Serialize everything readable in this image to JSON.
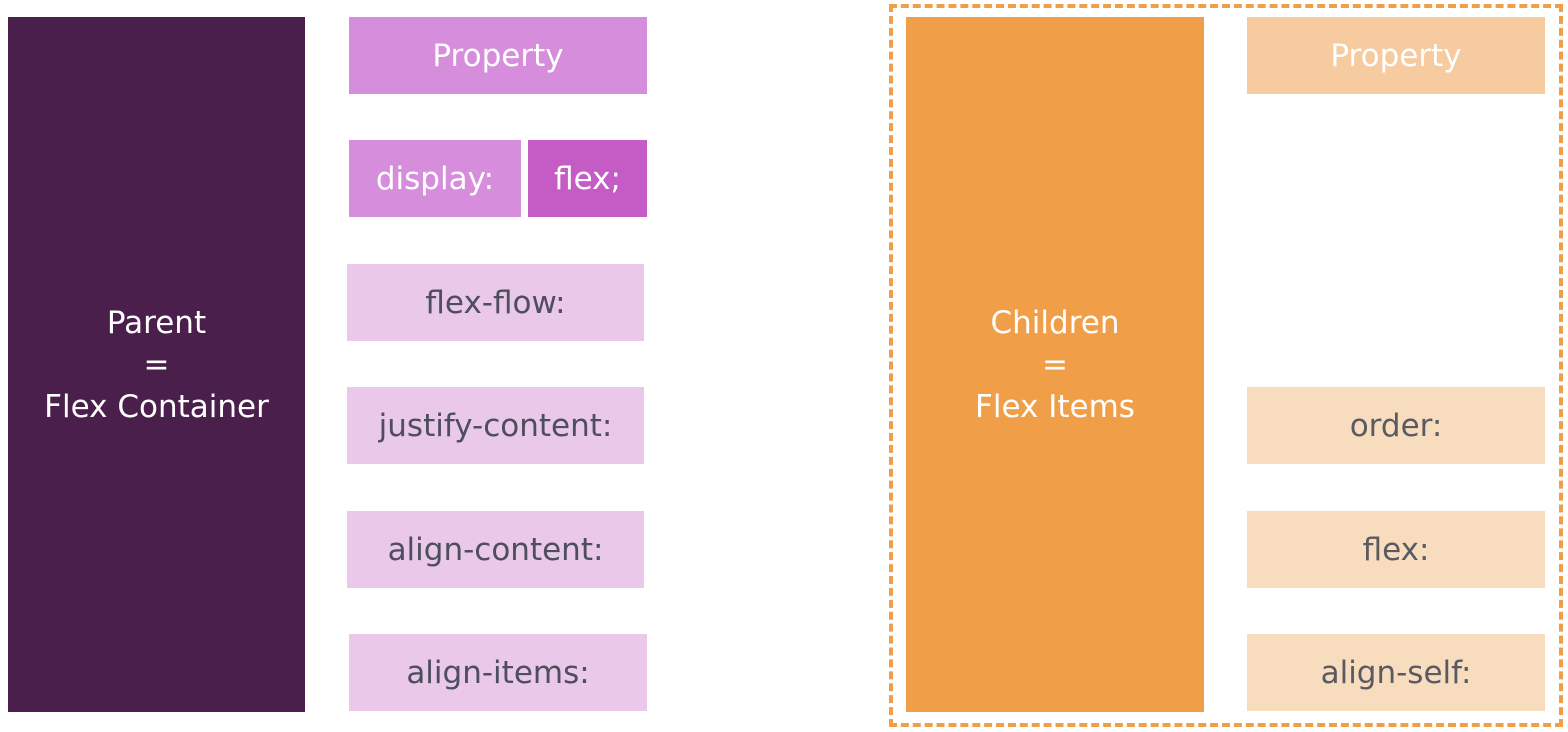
{
  "parent": {
    "line1": "Parent",
    "line2": "=",
    "line3": "Flex Container",
    "color": "#4b1f4b"
  },
  "children": {
    "line1": "Children",
    "line2": "=",
    "line3": "Flex Items",
    "color": "#f09e48"
  },
  "parent_properties": {
    "header": "Property",
    "display_label": "display:",
    "display_value": "flex;",
    "items": [
      "flex-flow:",
      "justify-content:",
      "align-content:",
      "align-items:"
    ]
  },
  "children_properties": {
    "header": "Property",
    "items": [
      "order:",
      "flex:",
      "align-self:"
    ]
  }
}
